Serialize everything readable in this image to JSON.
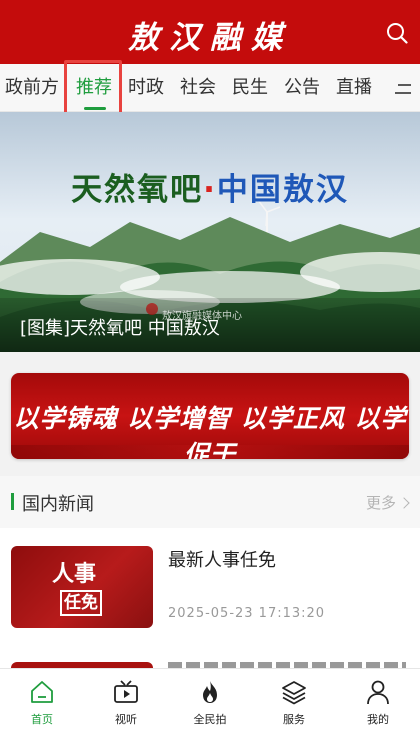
{
  "header": {
    "title": "敖汉融媒"
  },
  "tabs": [
    {
      "label": "政前方"
    },
    {
      "label": "推荐",
      "active": true
    },
    {
      "label": "时政"
    },
    {
      "label": "社会"
    },
    {
      "label": "民生"
    },
    {
      "label": "公告"
    },
    {
      "label": "直播"
    }
  ],
  "banner": {
    "title_part1": "天然氧吧",
    "title_dot": "·",
    "title_part2": "中国敖汉",
    "watermark": "敖汉旗融媒体中心",
    "caption": "[图集]天然氧吧  中国敖汉"
  },
  "slogan": {
    "text": "以学铸魂 以学增智 以学正风 以学促干"
  },
  "section": {
    "title": "国内新闻",
    "more_label": "更多"
  },
  "news": [
    {
      "thumb_line1": "人事",
      "thumb_line2": "任免",
      "title": "最新人事任免",
      "time": "2025-05-23  17:13:20"
    }
  ],
  "bottom_nav": [
    {
      "label": "首页",
      "icon": "home-icon",
      "active": true
    },
    {
      "label": "视听",
      "icon": "tv-icon"
    },
    {
      "label": "全民拍",
      "icon": "fire-icon"
    },
    {
      "label": "服务",
      "icon": "layers-icon"
    },
    {
      "label": "我的",
      "icon": "user-icon"
    }
  ],
  "colors": {
    "brand_red": "#c40c0c",
    "active_green": "#1f9d3e",
    "highlight_red": "#e8433f"
  }
}
